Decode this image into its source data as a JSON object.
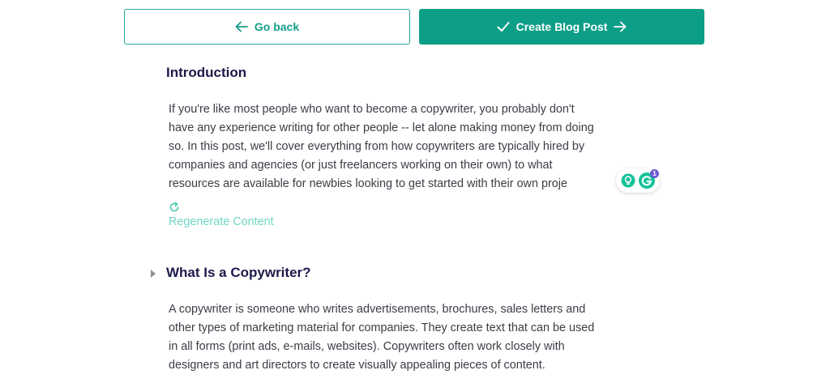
{
  "toolbar": {
    "back_label": "Go back",
    "create_label": "Create Blog Post"
  },
  "sections": [
    {
      "title": "Introduction",
      "lines": [
        "If you're like most people who want to become a copywriter, you probably don't",
        "have any experience writing for other people -- let alone making money from doing",
        "so. In this post, we'll cover everything from how copywriters are typically hired by",
        "companies and agencies (or just freelancers working on their own) to what",
        "resources are available for newbies looking to get started with their own proje"
      ],
      "regenerate_label": "Regenerate Content"
    },
    {
      "title": "What Is a Copywriter?",
      "lines": [
        "A copywriter is someone who writes advertisements, brochures, sales letters and",
        "other types of marketing material for companies. They create text that can be used",
        "in all forms (print ads, e-mails, websites). Copywriters often work closely with",
        "designers and art directors to create visually appealing pieces of content."
      ]
    }
  ],
  "grammarly": {
    "badge_count": "1"
  },
  "colors": {
    "accent": "#0d9e87",
    "accent_light": "#6fd6c6",
    "heading": "#1c1a4a",
    "body_text": "#3c3c46"
  },
  "icons": {
    "back": "arrow-left-icon",
    "create_check": "check-icon",
    "create_arrow": "arrow-right-icon",
    "regenerate": "refresh-icon",
    "collapse": "caret-right-icon",
    "grammarly_bulb": "lightbulb-icon",
    "grammarly_logo": "grammarly-g-icon"
  }
}
